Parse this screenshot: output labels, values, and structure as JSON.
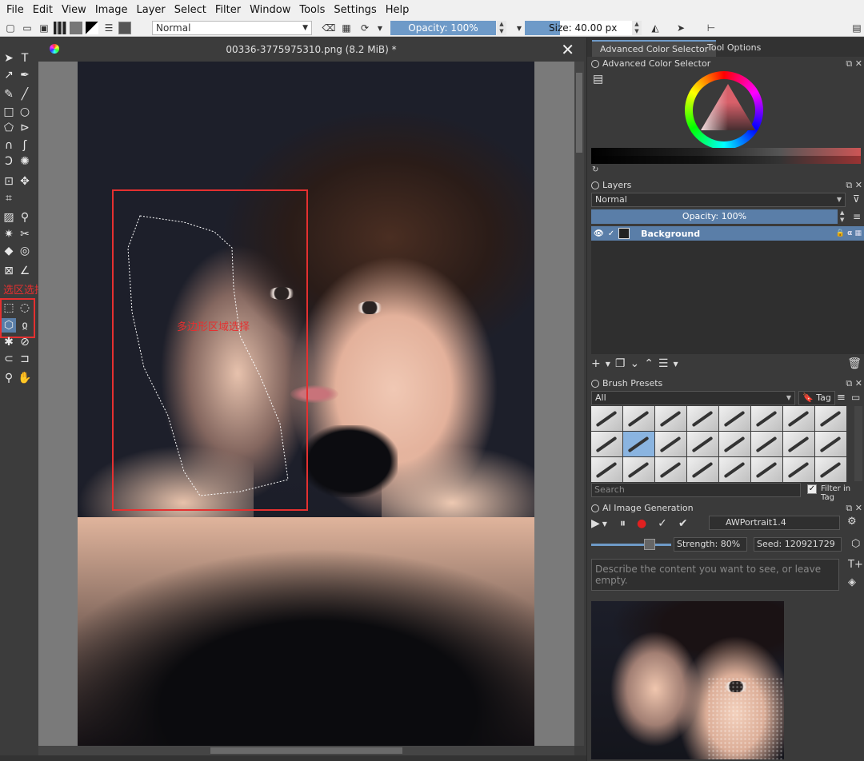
{
  "menu": [
    "File",
    "Edit",
    "View",
    "Image",
    "Layer",
    "Select",
    "Filter",
    "Window",
    "Tools",
    "Settings",
    "Help"
  ],
  "toolbar": {
    "blend_mode": "Normal",
    "opacity": "Opacity: 100%",
    "size": "Size: 40.00 px"
  },
  "toolbox": {
    "annotation_label": "选区选择工具"
  },
  "document": {
    "title": "00336-3775975310.png (8.2 MiB) *",
    "close": "✕",
    "annotation_label": "多边形区域选择"
  },
  "dock": {
    "tabs": [
      "Advanced Color Selector",
      "Tool Options"
    ],
    "color_selector_title": "Advanced Color Selector",
    "layers": {
      "title": "Layers",
      "blend_mode": "Normal",
      "opacity": "Opacity:  100%",
      "layer_name": "Background"
    },
    "brush_presets": {
      "title": "Brush Presets",
      "filter": "All",
      "tag": "Tag",
      "search_placeholder": "Search",
      "filter_in_tag": "Filter in Tag"
    },
    "ai": {
      "title": "AI Image Generation",
      "model": "AWPortrait1.4",
      "strength": "Strength: 80%",
      "seed": "Seed: 120921729",
      "prompt_placeholder": "Describe the content you want to see, or leave empty."
    }
  },
  "colors": {
    "accent": "#6e9ac8",
    "annotation": "#e53030",
    "background": "#3b3b3b"
  }
}
